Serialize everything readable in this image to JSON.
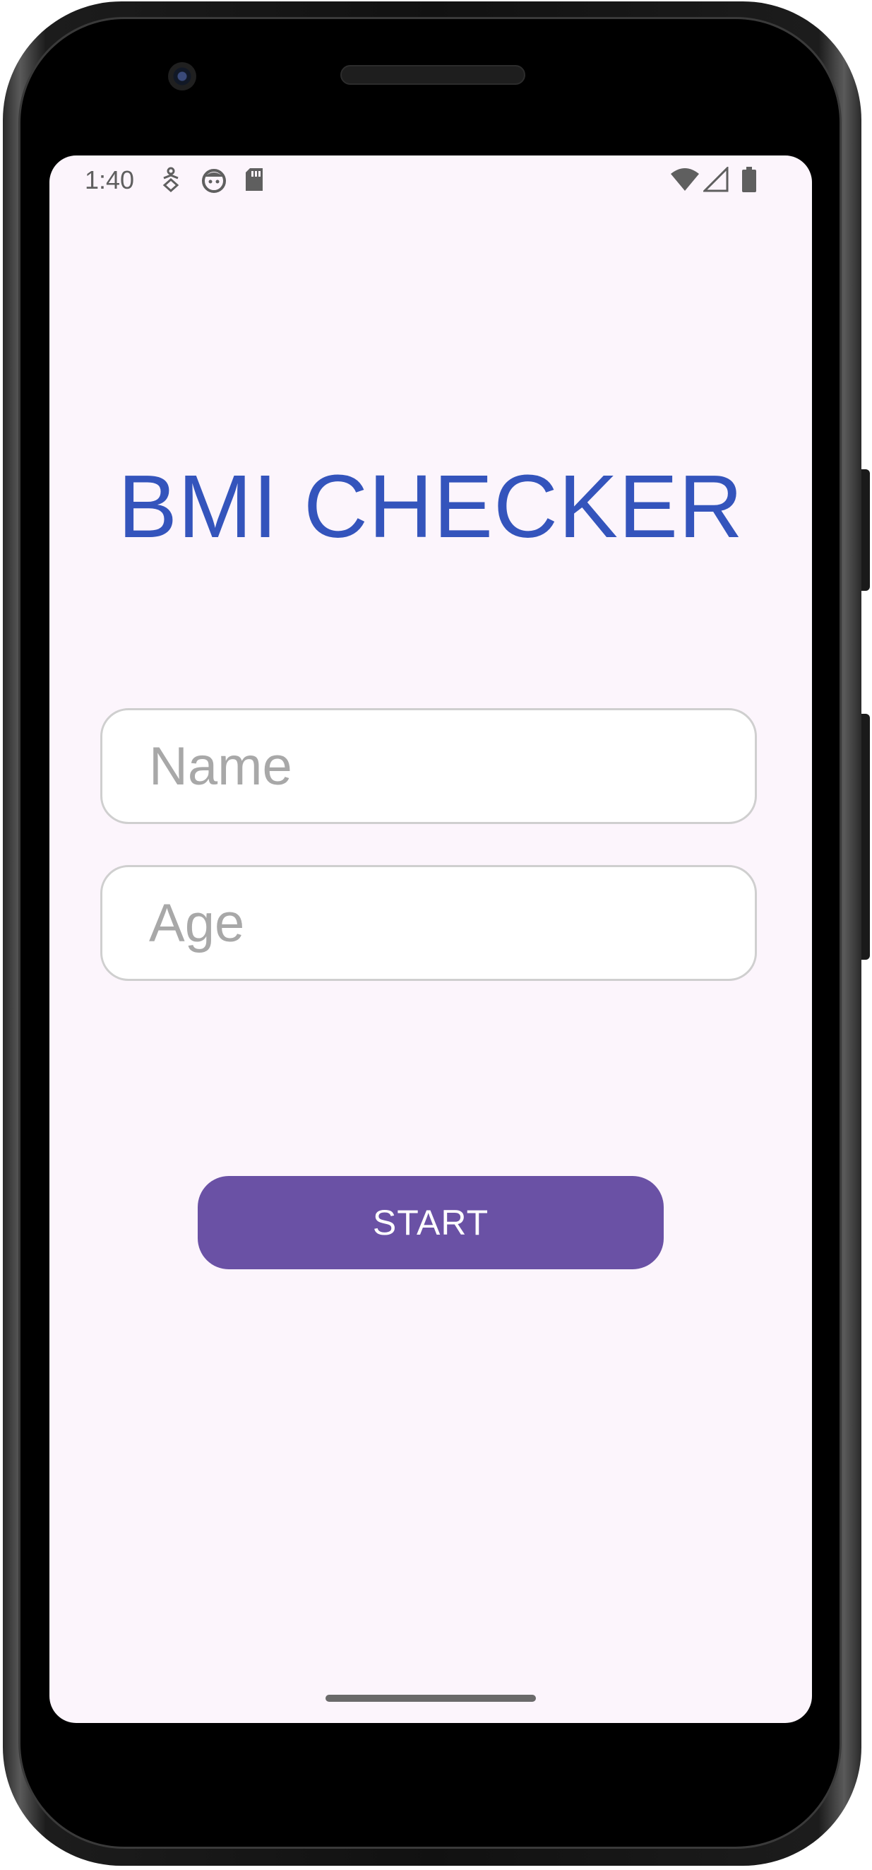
{
  "status_bar": {
    "time": "1:40",
    "left_icons": [
      "accessibility-icon",
      "face-icon",
      "sd-card-icon"
    ],
    "right_icons": [
      "wifi-icon",
      "signal-icon",
      "battery-icon"
    ]
  },
  "app": {
    "title": "BMI CHECKER"
  },
  "form": {
    "name_placeholder": "Name",
    "age_placeholder": "Age",
    "start_label": "START"
  },
  "colors": {
    "background": "#fcf5fc",
    "title": "#3454bc",
    "button": "#6a51a5",
    "button_text": "#ffffff",
    "field_border": "#cfcfcf",
    "placeholder": "#a8a8a8"
  }
}
